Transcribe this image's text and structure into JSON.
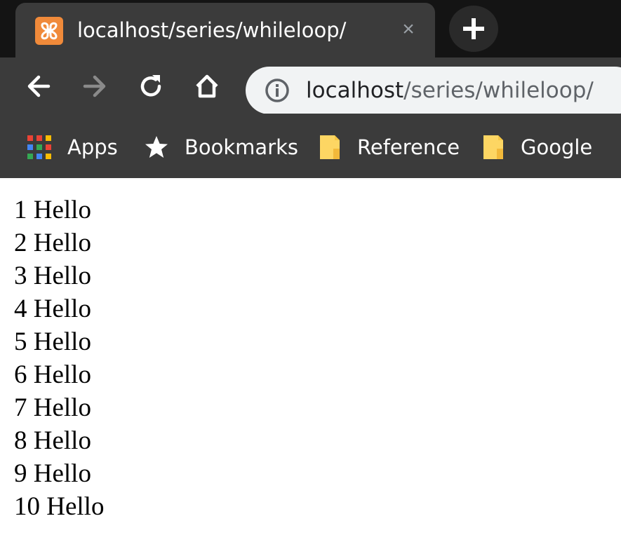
{
  "tab": {
    "title": "localhost/series/whileloop/",
    "close_glyph": "×",
    "favicon": "xampp-icon"
  },
  "toolbar": {
    "url_host": "localhost",
    "url_path": "/series/whileloop/"
  },
  "bookmarks": [
    {
      "label": "Apps",
      "icon": "apps-grid-icon"
    },
    {
      "label": "Bookmarks",
      "icon": "star-icon"
    },
    {
      "label": "Reference",
      "icon": "folder-icon"
    },
    {
      "label": "Google",
      "icon": "folder-icon"
    }
  ],
  "content": {
    "lines": [
      "1 Hello",
      "2 Hello",
      "3 Hello",
      "4 Hello",
      "5 Hello",
      "6 Hello",
      "7 Hello",
      "8 Hello",
      "9 Hello",
      "10 Hello"
    ]
  },
  "colors": {
    "chrome_bg": "#3b3b3b",
    "tabstrip_bg": "#141414",
    "omnibox_bg": "#f1f3f4",
    "favicon": "#f08a3a",
    "folder": "#fdd663"
  }
}
